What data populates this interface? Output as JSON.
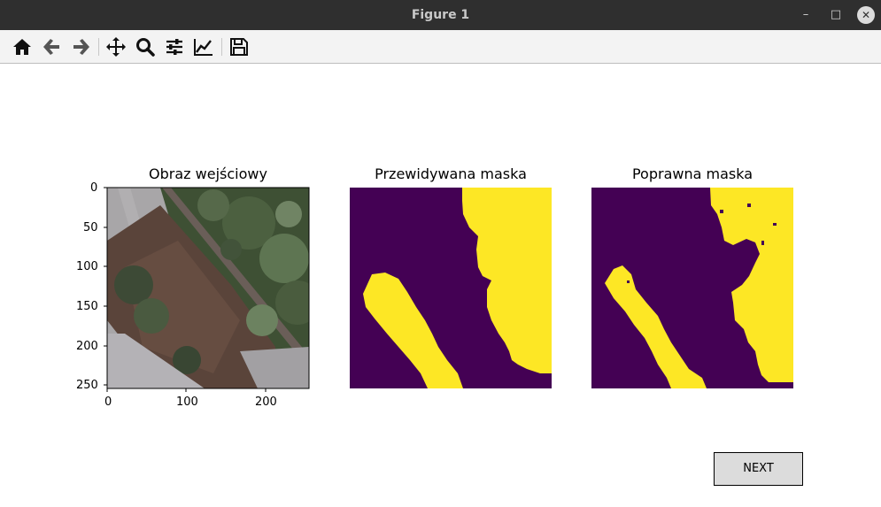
{
  "window": {
    "title": "Figure 1",
    "minimize_label": "–",
    "maximize_label": "□",
    "close_label": "✕"
  },
  "toolbar": {
    "buttons": [
      {
        "icon": "home-icon"
      },
      {
        "icon": "back-arrow-icon"
      },
      {
        "icon": "forward-arrow-icon"
      },
      {
        "icon": "pan-icon"
      },
      {
        "icon": "zoom-icon"
      },
      {
        "icon": "subplots-config-icon"
      },
      {
        "icon": "edit-curves-icon"
      },
      {
        "icon": "save-icon"
      }
    ]
  },
  "figure": {
    "panels": [
      {
        "title": "Obraz wejściowy"
      },
      {
        "title": "Przewidywana maska"
      },
      {
        "title": "Poprawna maska"
      }
    ],
    "y_ticks": [
      "0",
      "50",
      "100",
      "150",
      "200",
      "250"
    ],
    "x_ticks": [
      "0",
      "100",
      "200"
    ]
  },
  "colors": {
    "mask_background": "#440154",
    "mask_foreground": "#fde725",
    "road": "#a8a6a8",
    "forest": "#3e5034",
    "shadow": "#5a443a"
  },
  "next_button": {
    "label": "NEXT"
  }
}
